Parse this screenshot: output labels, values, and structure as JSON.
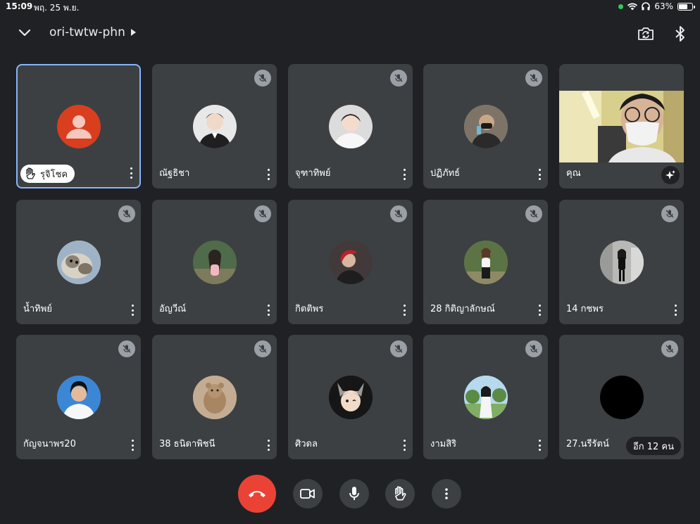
{
  "status_bar": {
    "time": "15:09",
    "date": "พฤ. 25 พ.ย.",
    "battery": "63%"
  },
  "header": {
    "meeting_code": "ori-twtw-phn",
    "icons": [
      "chevron-down-icon",
      "camera-switch-icon",
      "bluetooth-icon"
    ]
  },
  "participants": [
    {
      "name": "รุจิโชค",
      "hand_raised": true,
      "muted": false,
      "pinned_active": true
    },
    {
      "name": "ณัฐธิชา",
      "muted": true
    },
    {
      "name": "จุฑาทิพย์",
      "muted": true
    },
    {
      "name": "ปฏิภัทธ์",
      "muted": true
    },
    {
      "name": "คุณ",
      "self": true,
      "muted": false
    },
    {
      "name": "น้ำทิพย์",
      "muted": true
    },
    {
      "name": "อัญวีณ์",
      "muted": true
    },
    {
      "name": "กิตติพร",
      "muted": true
    },
    {
      "name": "28 กิติญาลักษณ์",
      "muted": true
    },
    {
      "name": "14 กชพร",
      "muted": true
    },
    {
      "name": "กัญจนาพร20",
      "muted": true
    },
    {
      "name": "38 ธนิดาพิชนี",
      "muted": true
    },
    {
      "name": "ศิวดล",
      "muted": true
    },
    {
      "name": "งามสิริ",
      "muted": true
    },
    {
      "name": "27.นรีรัตน์",
      "muted": true
    }
  ],
  "more_participants_label": "อีก 12 คน",
  "controls": [
    "end-call",
    "camera",
    "microphone",
    "raise-hand",
    "more-options"
  ],
  "colors": {
    "background": "#202124",
    "tile": "#3c4043",
    "active_border": "#8ab4f8",
    "end_call": "#ea4335",
    "avatar_default": "#d93e1e"
  }
}
